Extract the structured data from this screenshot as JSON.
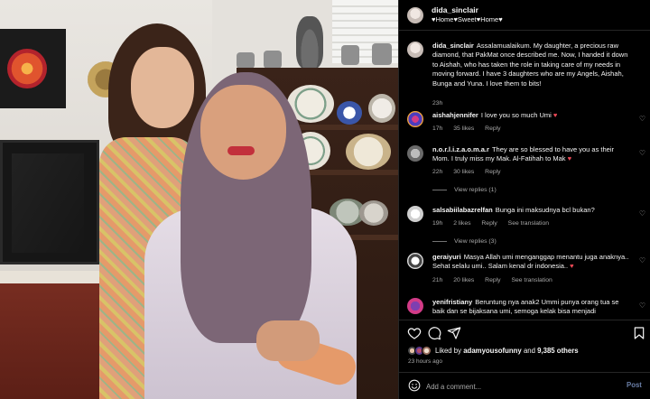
{
  "post": {
    "username": "dida_sinclair",
    "subtitle": "♥Home♥Sweet♥Home♥"
  },
  "caption": {
    "username": "dida_sinclair",
    "text": "Assalamualaikum. My daughter, a precious raw diamond, that PakMat once described me. Now, I handed it down to Aishah, who has taken the role in taking care of my needs in moving forward. I have 3 daughters who are my Angels, Aishah, Bunga and Yuna. I love them to bits!",
    "time": "23h"
  },
  "comments": [
    {
      "username": "aishahjennifer",
      "text": "I love you so much Umi ♥",
      "time": "17h",
      "likes": "35 likes",
      "reply": "Reply"
    },
    {
      "username": "n.o.r.l.i.z.a.o.m.a.r",
      "text": "They are so blessed to have you as their Mom. I truly miss my Mak. Al-Fatihah to Mak ♥",
      "time": "22h",
      "likes": "30 likes",
      "reply": "Reply",
      "view_replies": "View replies (1)"
    },
    {
      "username": "salsabiilabazrelfan",
      "text": "Bunga ini maksudnya bcl bukan?",
      "time": "19h",
      "likes": "2 likes",
      "reply": "Reply",
      "translation": "See translation",
      "view_replies": "View replies (3)"
    },
    {
      "username": "geraiyuri",
      "text": "Masya Allah umi menganggap menantu juga anaknya.. Sehat selalu umi.. Salam kenal dr indonesia.. ♥",
      "time": "21h",
      "likes": "20 likes",
      "reply": "Reply",
      "translation": "See translation"
    },
    {
      "username": "yenifristiany",
      "text": "Beruntung nya anak2 Ummi punya orang tua se baik dan se bijaksana umi, semoga kelak bisa menjadi"
    }
  ],
  "actions": {
    "liked_by_prefix": "Liked by ",
    "liked_by_user": "adamyousofunny",
    "liked_by_and": " and ",
    "liked_by_others": "9,385 others",
    "time": "23 hours ago"
  },
  "add_comment": {
    "placeholder": "Add a comment...",
    "post_label": "Post"
  },
  "colors": {
    "panel_bg": "#000000",
    "text": "#f5f5f5",
    "muted": "#a8a8a8",
    "heart_red": "#ed4956",
    "post_button": "#6b7fa8"
  }
}
